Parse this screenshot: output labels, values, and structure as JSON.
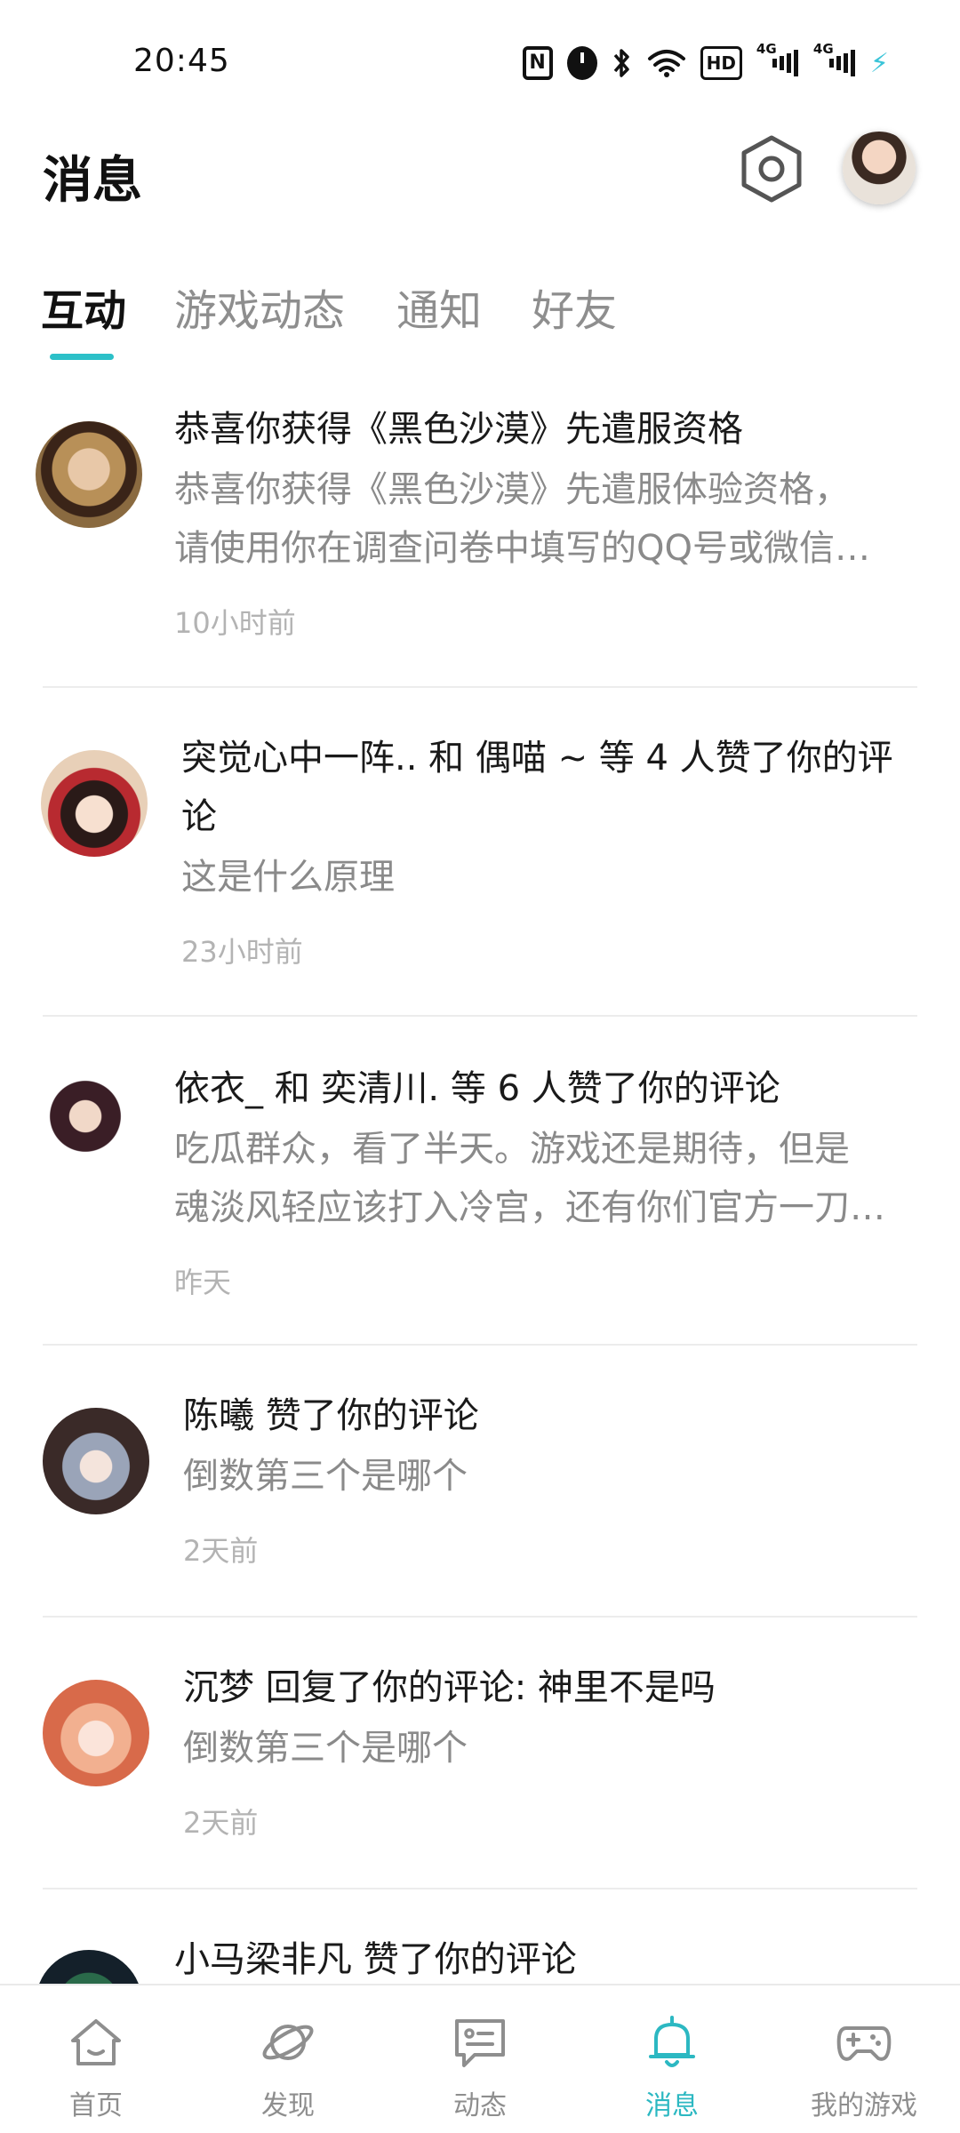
{
  "status_bar": {
    "time": "20:45",
    "icons": [
      "nfc-icon",
      "alarm-icon",
      "bluetooth-icon",
      "wifi-icon",
      "hd-icon",
      "signal-4g-icon",
      "signal-4g-icon",
      "charging-icon"
    ],
    "nfc_label": "N",
    "hd_label": "HD",
    "network_label_1": "4G",
    "network_label_2": "4G",
    "charging_glyph": "⚡"
  },
  "header": {
    "title": "消息"
  },
  "tabs": [
    {
      "label": "互动",
      "active": true
    },
    {
      "label": "游戏动态",
      "active": false
    },
    {
      "label": "通知",
      "active": false
    },
    {
      "label": "好友",
      "active": false
    }
  ],
  "messages": [
    {
      "title": "恭喜你获得《黑色沙漠》先遣服资格",
      "body_line1": "恭喜你获得《黑色沙漠》先遣服体验资格，",
      "body_line2": "请使用你在调查问卷中填写的QQ号或微信…",
      "time": "10小时前"
    },
    {
      "title_line1": "突觉心中一阵.. 和 偶喵 ~  等 4 人赞了你的评",
      "title_line2": "论",
      "body": "这是什么原理",
      "time": "23小时前"
    },
    {
      "title": "依衣_ 和 奕清川. 等 6 人赞了你的评论",
      "body_line1": "吃瓜群众，看了半天。游戏还是期待，但是",
      "body_line2": "魂淡风轻应该打入冷宫，还有你们官方一刀…",
      "time": "昨天"
    },
    {
      "title": "陈曦 赞了你的评论",
      "body": "倒数第三个是哪个",
      "time": "2天前"
    },
    {
      "title": "沉梦 回复了你的评论: 神里不是吗",
      "body": "倒数第三个是哪个",
      "time": "2天前"
    },
    {
      "title": "小马梁非凡 赞了你的评论"
    }
  ],
  "bottom_nav": [
    {
      "label": "首页",
      "icon": "home-icon",
      "active": false
    },
    {
      "label": "发现",
      "icon": "planet-icon",
      "active": false
    },
    {
      "label": "动态",
      "icon": "chat-icon",
      "active": false
    },
    {
      "label": "消息",
      "icon": "bell-icon",
      "active": true
    },
    {
      "label": "我的游戏",
      "icon": "gamepad-icon",
      "active": false
    }
  ],
  "colors": {
    "accent": "#2cc0c8",
    "title_text": "#1a1a1a",
    "secondary_text": "#8a8a8a",
    "timestamp_text": "#b3b3b3"
  }
}
